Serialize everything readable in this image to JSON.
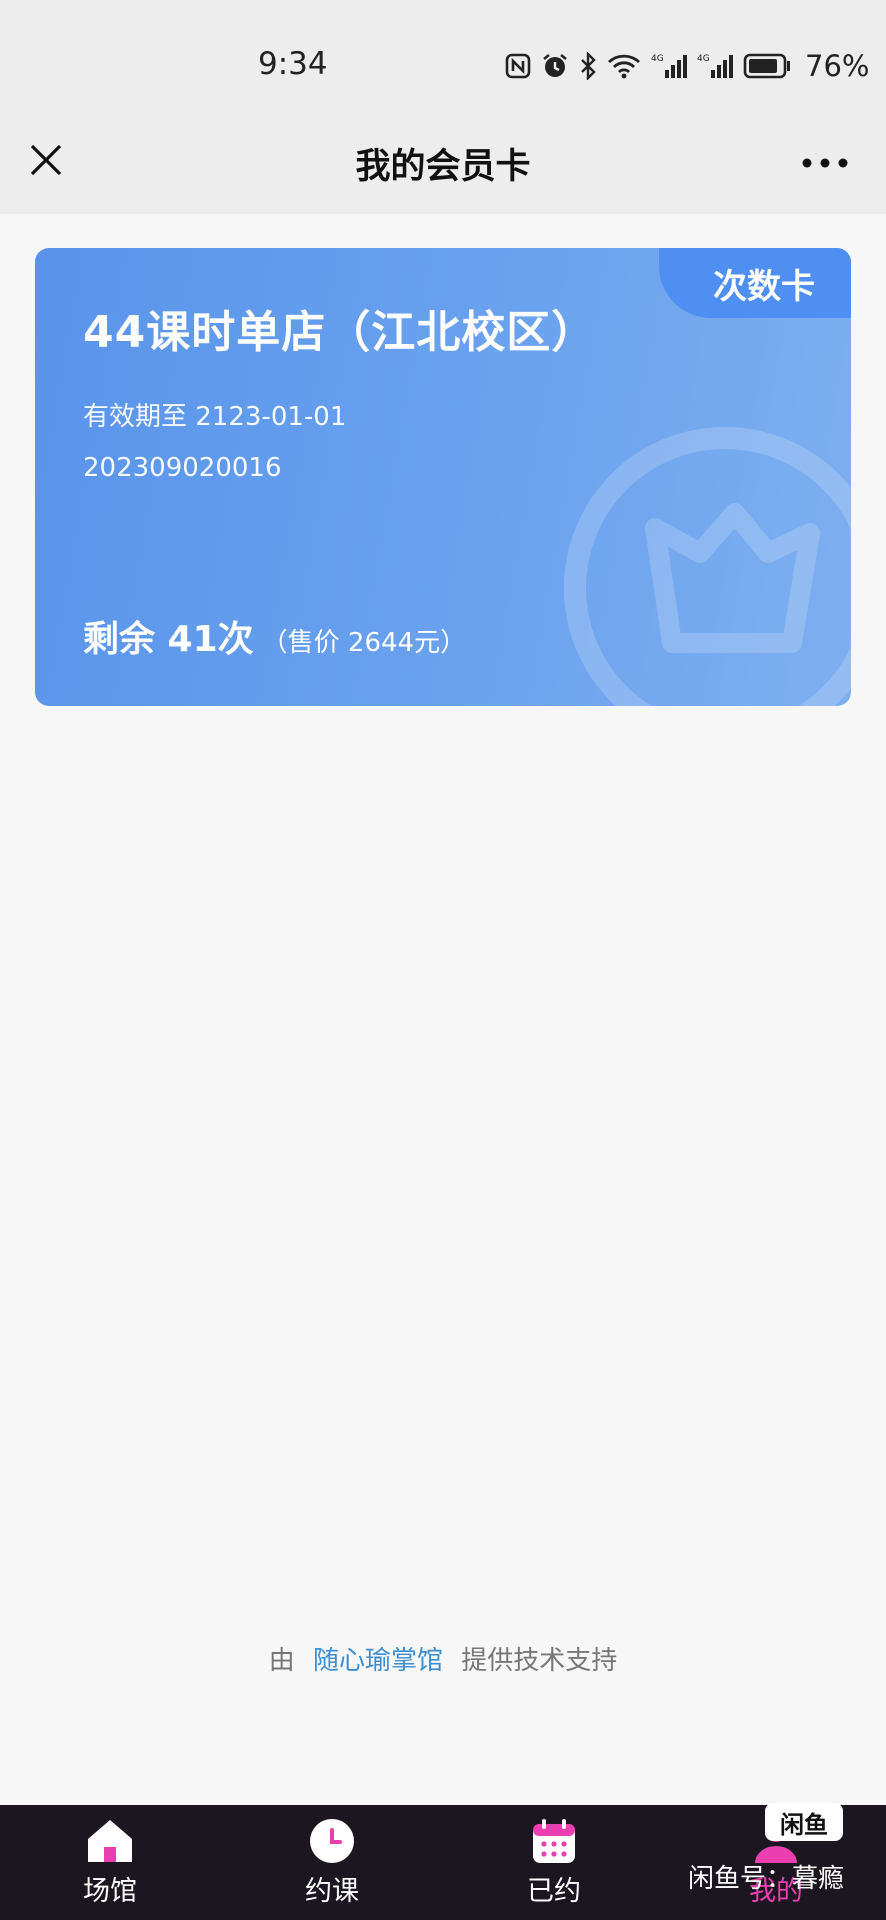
{
  "status_bar": {
    "time": "9:34",
    "battery": "76%"
  },
  "header": {
    "title": "我的会员卡"
  },
  "card": {
    "badge": "次数卡",
    "title": "44课时单店（江北校区）",
    "expiry": "有效期至 2123-01-01",
    "number": "202309020016",
    "remaining": "剩余 41次",
    "price": "（售价 2644元）",
    "color": "#5f9aec"
  },
  "footer": {
    "prefix": "由",
    "brand": "随心瑜掌馆",
    "suffix": "提供技术支持"
  },
  "tabbar": {
    "active_color": "#e93fb1",
    "items": [
      {
        "label": "场馆",
        "icon": "home-icon"
      },
      {
        "label": "约课",
        "icon": "clock-icon"
      },
      {
        "label": "已约",
        "icon": "calendar-icon"
      },
      {
        "label": "我的",
        "icon": "user-icon"
      }
    ]
  },
  "watermark": {
    "logo": "闲鱼",
    "text": "闲鱼号：暮瘾"
  }
}
